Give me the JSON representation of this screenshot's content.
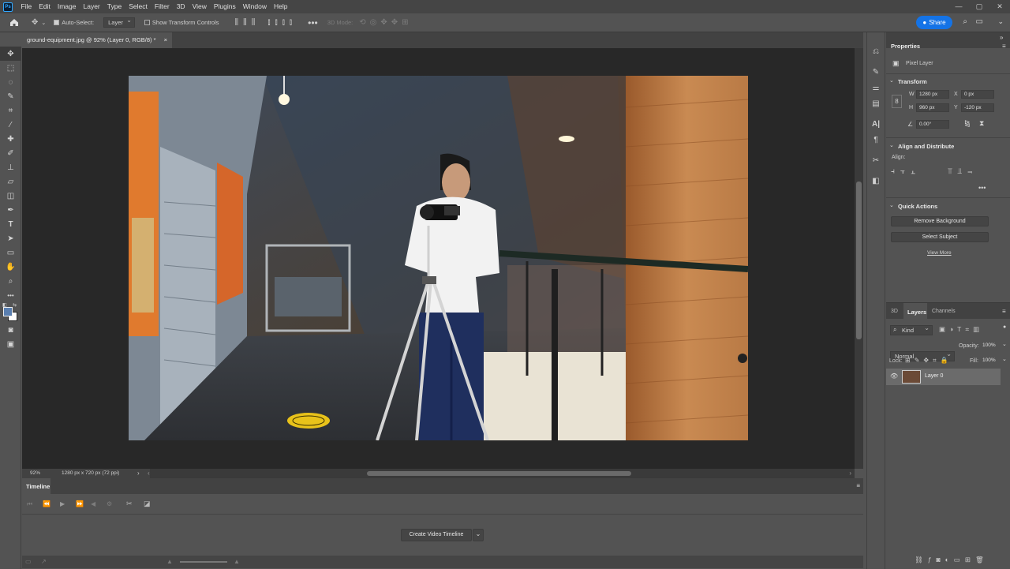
{
  "menu": {
    "logo": "Ps",
    "items": [
      "File",
      "Edit",
      "Image",
      "Layer",
      "Type",
      "Select",
      "Filter",
      "3D",
      "View",
      "Plugins",
      "Window",
      "Help"
    ]
  },
  "options": {
    "auto_select_label": "Auto-Select:",
    "auto_select_target": "Layer",
    "show_transform_label": "Show Transform Controls",
    "mode_3d_label": "3D Mode:",
    "share_label": "Share"
  },
  "document": {
    "tab_title": "ground-equipment.jpg @ 92% (Layer 0, RGB/8) *",
    "zoom": "92%",
    "doc_info": "1280 px x 720 px (72 ppi)"
  },
  "properties": {
    "tab": "Properties",
    "layer_type": "Pixel Layer",
    "transform_title": "Transform",
    "w_label": "W",
    "w_value": "1280 px",
    "h_label": "H",
    "h_value": "960 px",
    "x_label": "X",
    "x_value": "0 px",
    "y_label": "Y",
    "y_value": "-120 px",
    "angle_value": "0.00°",
    "align_title": "Align and Distribute",
    "align_label": "Align:",
    "quick_title": "Quick Actions",
    "remove_bg": "Remove Background",
    "select_subject": "Select Subject",
    "view_more": "View More"
  },
  "layers": {
    "tabs": [
      "3D",
      "Layers",
      "Channels"
    ],
    "filter_kind": "Kind",
    "blend_mode": "Normal",
    "opacity_label": "Opacity:",
    "opacity_value": "100%",
    "lock_label": "Lock:",
    "fill_label": "Fill:",
    "fill_value": "100%",
    "layer_name": "Layer 0"
  },
  "timeline": {
    "title": "Timeline",
    "create_button": "Create Video Timeline"
  },
  "colors": {
    "accent": "#1473e6",
    "foreground": "#5a7fb0",
    "background": "#ffffff"
  }
}
